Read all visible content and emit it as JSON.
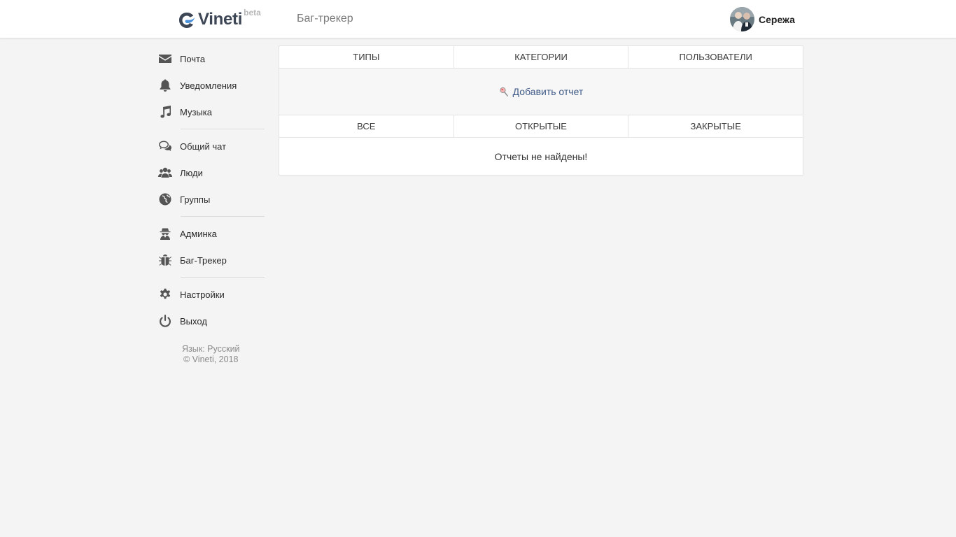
{
  "header": {
    "logo_text": "Vineti",
    "logo_beta": "beta",
    "page_title": "Баг-трекер",
    "user_name": "Сережа"
  },
  "sidebar": {
    "items": [
      {
        "label": "Почта",
        "icon": "mail-icon"
      },
      {
        "label": "Уведомления",
        "icon": "bell-icon"
      },
      {
        "label": "Музыка",
        "icon": "music-icon"
      },
      {
        "label": "Общий чат",
        "icon": "chat-icon"
      },
      {
        "label": "Люди",
        "icon": "people-icon"
      },
      {
        "label": "Группы",
        "icon": "globe-icon"
      },
      {
        "label": "Админка",
        "icon": "spy-icon"
      },
      {
        "label": "Баг-Трекер",
        "icon": "bug-icon"
      },
      {
        "label": "Настройки",
        "icon": "gear-icon"
      },
      {
        "label": "Выход",
        "icon": "power-icon"
      }
    ],
    "language": "Язык: Русский",
    "copyright": "© Vineti, 2018"
  },
  "main": {
    "top_tabs": [
      "Типы",
      "Категории",
      "Пользователи"
    ],
    "add_report": "Добавить отчет",
    "filter_tabs": [
      "Все",
      "Открытые",
      "Закрытые"
    ],
    "empty_message": "Отчеты не найдены!"
  },
  "colors": {
    "link": "#3f5b87",
    "icon": "#555555",
    "background": "#f4f4f4"
  }
}
